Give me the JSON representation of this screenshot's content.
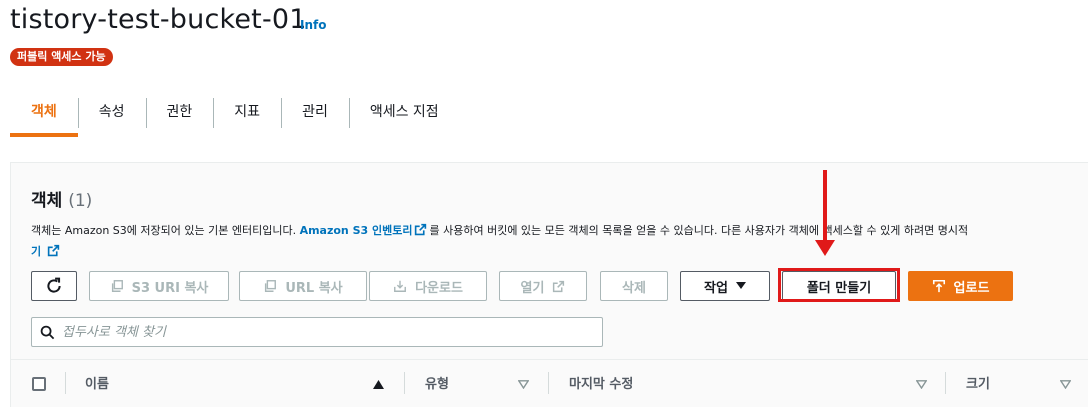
{
  "header": {
    "bucket_name": "tistory-test-bucket-01",
    "info_label": "Info",
    "access_badge": "퍼블릭 액세스 가능"
  },
  "tabs": [
    {
      "label": "객체",
      "active": true
    },
    {
      "label": "속성",
      "active": false
    },
    {
      "label": "권한",
      "active": false
    },
    {
      "label": "지표",
      "active": false
    },
    {
      "label": "관리",
      "active": false
    },
    {
      "label": "액세스 지점",
      "active": false
    }
  ],
  "objects_panel": {
    "title": "객체",
    "count": "(1)",
    "desc_part1": "객체는 Amazon S3에 저장되어 있는 기본 엔터티입니다. ",
    "desc_link": "Amazon S3 인벤토리",
    "desc_part2": "를 사용하여 버킷에 있는 모든 객체의 목록을 얻을 수 있습니다. 다른 사용자가 객체에 액세스할 수 있게 하려면 명시적",
    "desc_link2": "기"
  },
  "toolbar": {
    "refresh_icon": "refresh-icon",
    "copy_s3_uri": "S3 URI 복사",
    "copy_url": "URL 복사",
    "download": "다운로드",
    "open": "열기",
    "delete": "삭제",
    "actions": "작업",
    "create_folder": "폴더 만들기",
    "upload": "업로드"
  },
  "search": {
    "placeholder": "접두사로 객체 찾기"
  },
  "table": {
    "columns": [
      "이름",
      "유형",
      "마지막 수정",
      "크기"
    ]
  },
  "colors": {
    "accent_orange": "#ec7211",
    "link_blue": "#0073bb",
    "badge_red": "#d13212",
    "annotation_red": "#e01919"
  }
}
